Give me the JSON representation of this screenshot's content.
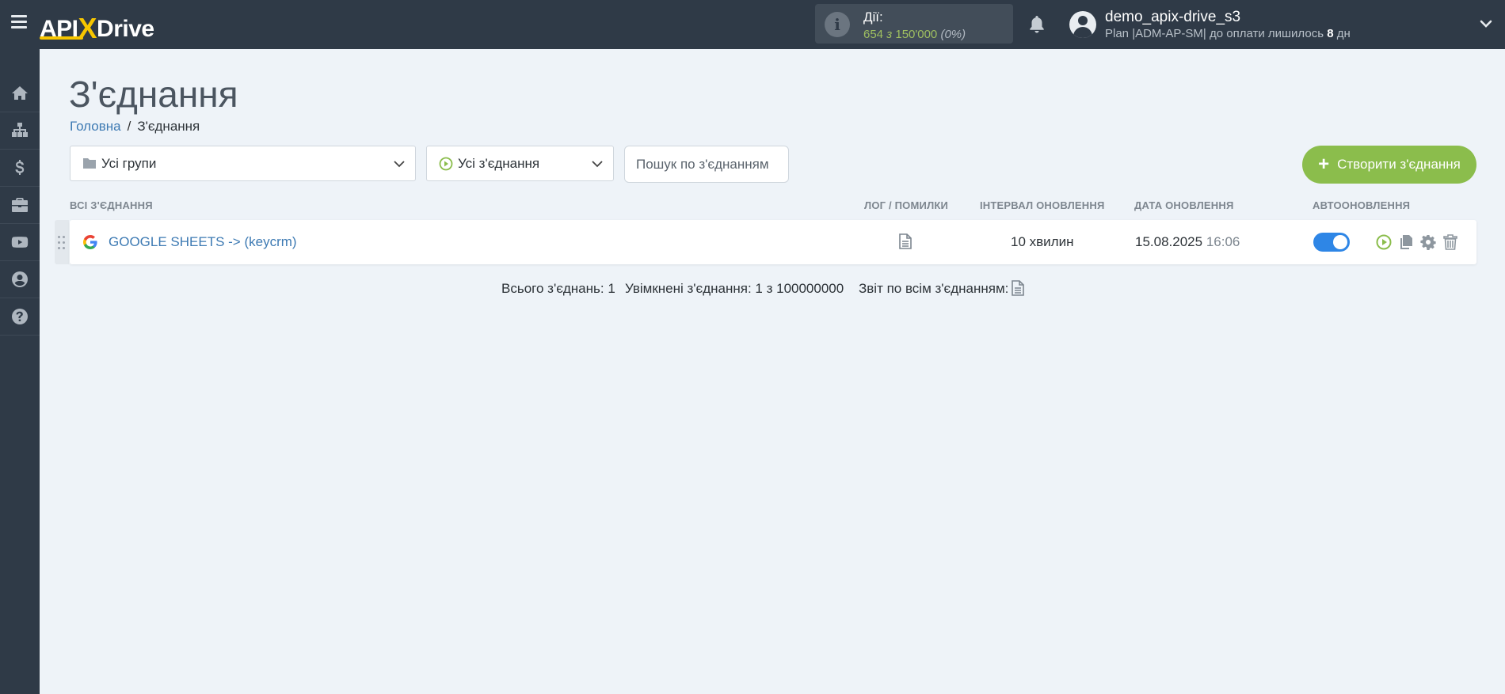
{
  "header": {
    "logo_text": "APIXDrive",
    "logo_left": "API",
    "logo_x": "X",
    "logo_right": "Drive",
    "actions_title": "Дії:",
    "actions_used": "654",
    "actions_of": "з",
    "actions_total": "150'000",
    "actions_percent": "(0%)",
    "username": "demo_apix-drive_s3",
    "plan_text": "Plan |ADM-AP-SM| до оплати лишилось",
    "plan_days": "8",
    "plan_days_suffix": "дн"
  },
  "sidebar": {
    "items": [
      {
        "icon": "home-icon"
      },
      {
        "icon": "sitemap-icon"
      },
      {
        "icon": "dollar-icon"
      },
      {
        "icon": "briefcase-icon"
      },
      {
        "icon": "youtube-icon"
      },
      {
        "icon": "user-circle-icon"
      },
      {
        "icon": "question-icon"
      }
    ]
  },
  "page": {
    "title": "З'єднання",
    "breadcrumb_home": "Головна",
    "breadcrumb_sep": "/",
    "breadcrumb_current": "З'єднання"
  },
  "filters": {
    "group_select": "Усі групи",
    "connection_select": "Усі з'єднання",
    "search_placeholder": "Пошук по з'єднанням",
    "create_button": "Створити з'єднання"
  },
  "table": {
    "headers": {
      "all": "ВСІ З'ЄДНАННЯ",
      "log": "ЛОГ / ПОМИЛКИ",
      "interval": "ІНТЕРВАЛ ОНОВЛЕННЯ",
      "date": "ДАТА ОНОВЛЕННЯ",
      "auto": "АВТООНОВЛЕННЯ"
    },
    "rows": [
      {
        "name": "GOOGLE SHEETS -> (keycrm)",
        "interval": "10 хвилин",
        "date": "15.08.2025",
        "time": "16:06",
        "auto_update": true
      }
    ]
  },
  "footer": {
    "total": "Всього з'єднань: 1",
    "enabled": "Увімкнені з'єднання: 1 з 100000000",
    "report": "Звіт по всім з'єднанням:"
  },
  "colors": {
    "topbar": "#2f3a47",
    "accent_green": "#8bbd4c",
    "link_blue": "#3d7ab3",
    "toggle_blue": "#2e86e6",
    "logo_yellow": "#f7c600"
  }
}
